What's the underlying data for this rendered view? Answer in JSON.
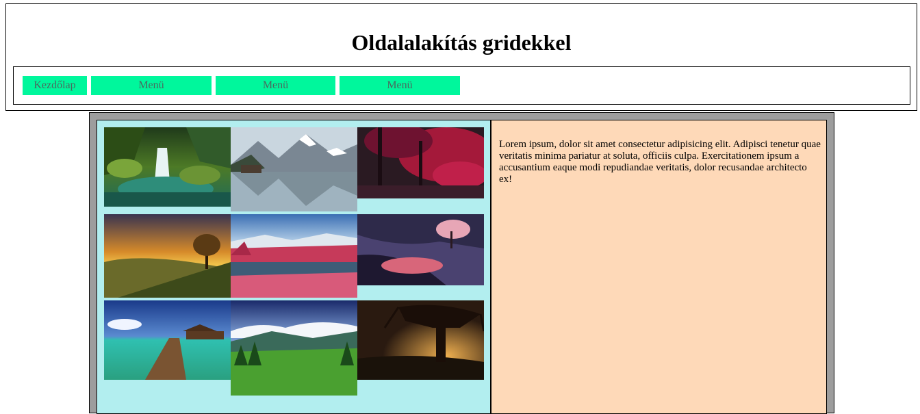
{
  "header": {
    "title": "Oldalalakítás gridekkel"
  },
  "nav": {
    "items": [
      {
        "label": "Kezdőlap"
      },
      {
        "label": "Menü"
      },
      {
        "label": "Menü"
      },
      {
        "label": "Menü"
      }
    ]
  },
  "content": {
    "text": "Lorem ipsum, dolor sit amet consectetur adipisicing elit. Adipisci tenetur quae veritatis minima pariatur at soluta, officiis culpa. Exercitationem ipsum a accusantium eaque modi repudiandae veritatis, dolor recusandae architecto ex!"
  },
  "gallery": {
    "images": [
      {
        "name": "waterfall-image"
      },
      {
        "name": "mountain-lake-image"
      },
      {
        "name": "red-forest-image"
      },
      {
        "name": "sunset-tree-image"
      },
      {
        "name": "pink-lake-image"
      },
      {
        "name": "pink-tree-cliff-image"
      },
      {
        "name": "pier-sea-image"
      },
      {
        "name": "green-valley-image"
      },
      {
        "name": "old-tree-sunset-image"
      }
    ]
  },
  "colors": {
    "nav_button": "#00f79c",
    "main_bg": "#9d9d9d",
    "gallery_bg": "#b2eeef",
    "text_panel_bg": "#fed9b8"
  }
}
